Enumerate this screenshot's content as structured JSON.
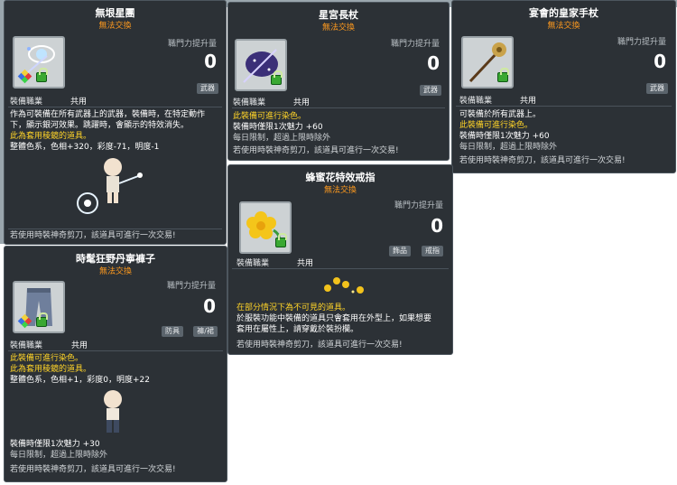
{
  "labels": {
    "power": "職門力提升量",
    "zero": "0",
    "job": "裝備職業",
    "share": "共用",
    "untradable": "無法交換"
  },
  "items": [
    {
      "name": "無垠星團",
      "icon": "star-cluster-weapon-icon",
      "tags": [
        "武器"
      ],
      "lines": [
        {
          "t": "作為可裝備在所有武器上的武器，裝備時，在特定動作",
          "c": "w"
        },
        {
          "t": "下，顯示銀河效果。跳躍時，會顯示的特效消失。",
          "c": "w"
        },
        {
          "t": "此為套用稜鏡的道具。",
          "c": "y"
        },
        {
          "t": "整體色系，色相+320，彩度-71，明度-1",
          "c": "w"
        },
        {
          "t": "若使用時裝神奇剪刀，該道具可進行一次交易!",
          "c": "s"
        }
      ]
    },
    {
      "name": "星宮長杖",
      "icon": "star-palace-staff-icon",
      "tags": [
        "武器"
      ],
      "lines": [
        {
          "t": "此裝備可進行染色。",
          "c": "y"
        },
        {
          "t": "裝備時僅限1次魅力 +60",
          "c": "w"
        },
        {
          "t": "每日限制，超過上限時除外",
          "c": "g"
        },
        {
          "t": "若使用時裝神奇剪刀，該道具可進行一次交易!",
          "c": "s"
        }
      ]
    },
    {
      "name": "宴會的皇家手杖",
      "icon": "royal-banquet-cane-icon",
      "tags": [
        "武器"
      ],
      "lines": [
        {
          "t": "可裝備於所有武器上。",
          "c": "w"
        },
        {
          "t": "此裝備可進行染色。",
          "c": "y"
        },
        {
          "t": "裝備時僅限1次魅力 +60",
          "c": "w"
        },
        {
          "t": "每日限制，超過上限時除外",
          "c": "g"
        },
        {
          "t": "若使用時裝神奇剪刀，該道具可進行一次交易!",
          "c": "s"
        }
      ]
    },
    {
      "name": "蜂蜜花特效戒指",
      "icon": "honey-flower-ring-icon",
      "tags": [
        "飾品",
        "戒指"
      ],
      "lines": [
        {
          "t": "在部分情況下為不可見的道具。",
          "c": "y"
        },
        {
          "t": "於服裝功能中裝備的道具只會套用在外型上，如果想要",
          "c": "w"
        },
        {
          "t": "套用在屬性上，請穿戴於裝扮欄。",
          "c": "w"
        },
        {
          "t": "若使用時裝神奇剪刀，該道具可進行一次交易!",
          "c": "s"
        }
      ]
    },
    {
      "name": "時髦狂野丹寧褲子",
      "icon": "denim-pants-icon",
      "tags": [
        "防具",
        "褲/裙"
      ],
      "lines": [
        {
          "t": "此裝備可進行染色。",
          "c": "y"
        },
        {
          "t": "此為套用稜鏡的道具。",
          "c": "y"
        },
        {
          "t": "整體色系，色相+1，彩度0，明度+22",
          "c": "w"
        },
        {
          "t": "裝備時僅限1次魅力 +30",
          "c": "w"
        },
        {
          "t": "每日限制，超過上限時除外",
          "c": "g"
        },
        {
          "t": "若使用時裝神奇剪刀，該道具可進行一次交易!",
          "c": "s"
        }
      ]
    }
  ]
}
